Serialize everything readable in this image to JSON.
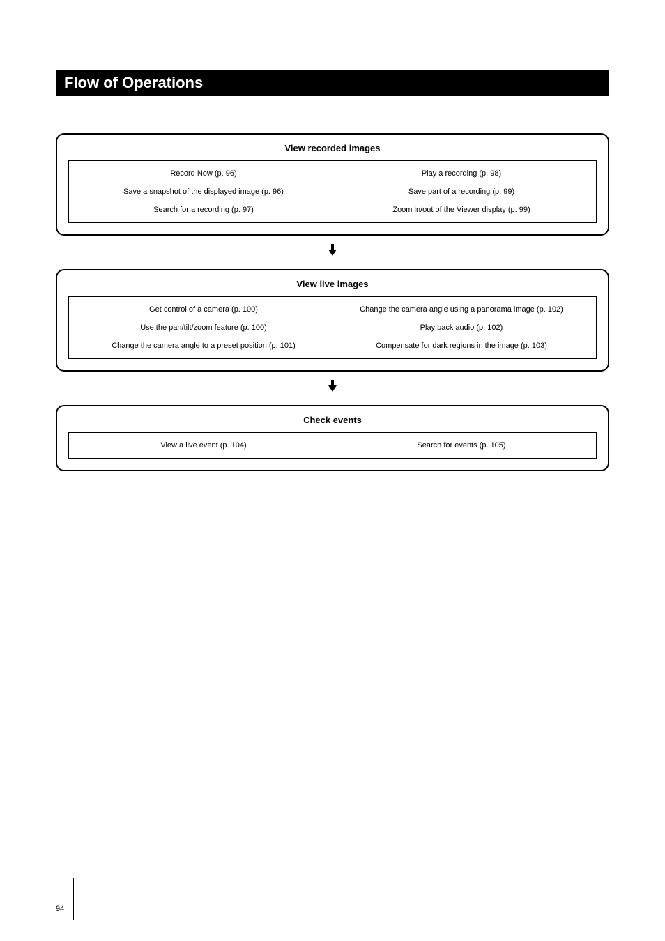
{
  "title": "Flow of Operations",
  "sections": [
    {
      "heading": "View recorded images",
      "rows": [
        {
          "left": "Record Now (p. 96)",
          "right": "Play a recording (p. 98)"
        },
        {
          "left": "Save a snapshot of the displayed image (p. 96)",
          "right": "Save part of a recording (p. 99)"
        },
        {
          "left": "Search for a recording (p. 97)",
          "right": "Zoom in/out of the Viewer display (p. 99)"
        }
      ]
    },
    {
      "heading": "View live images",
      "rows": [
        {
          "left": "Get control of a camera (p. 100)",
          "right": "Change the camera angle using a panorama image (p. 102)"
        },
        {
          "left": "Use the pan/tilt/zoom feature (p. 100)",
          "right": "Play back audio (p. 102)"
        },
        {
          "left": "Change the camera angle to a preset position (p. 101)",
          "right": "Compensate for dark regions in the image (p. 103)"
        }
      ]
    },
    {
      "heading": "Check events",
      "rows": [
        {
          "left": "View a live event (p. 104)",
          "right": "Search for events (p. 105)"
        }
      ]
    }
  ],
  "page_number": "94"
}
